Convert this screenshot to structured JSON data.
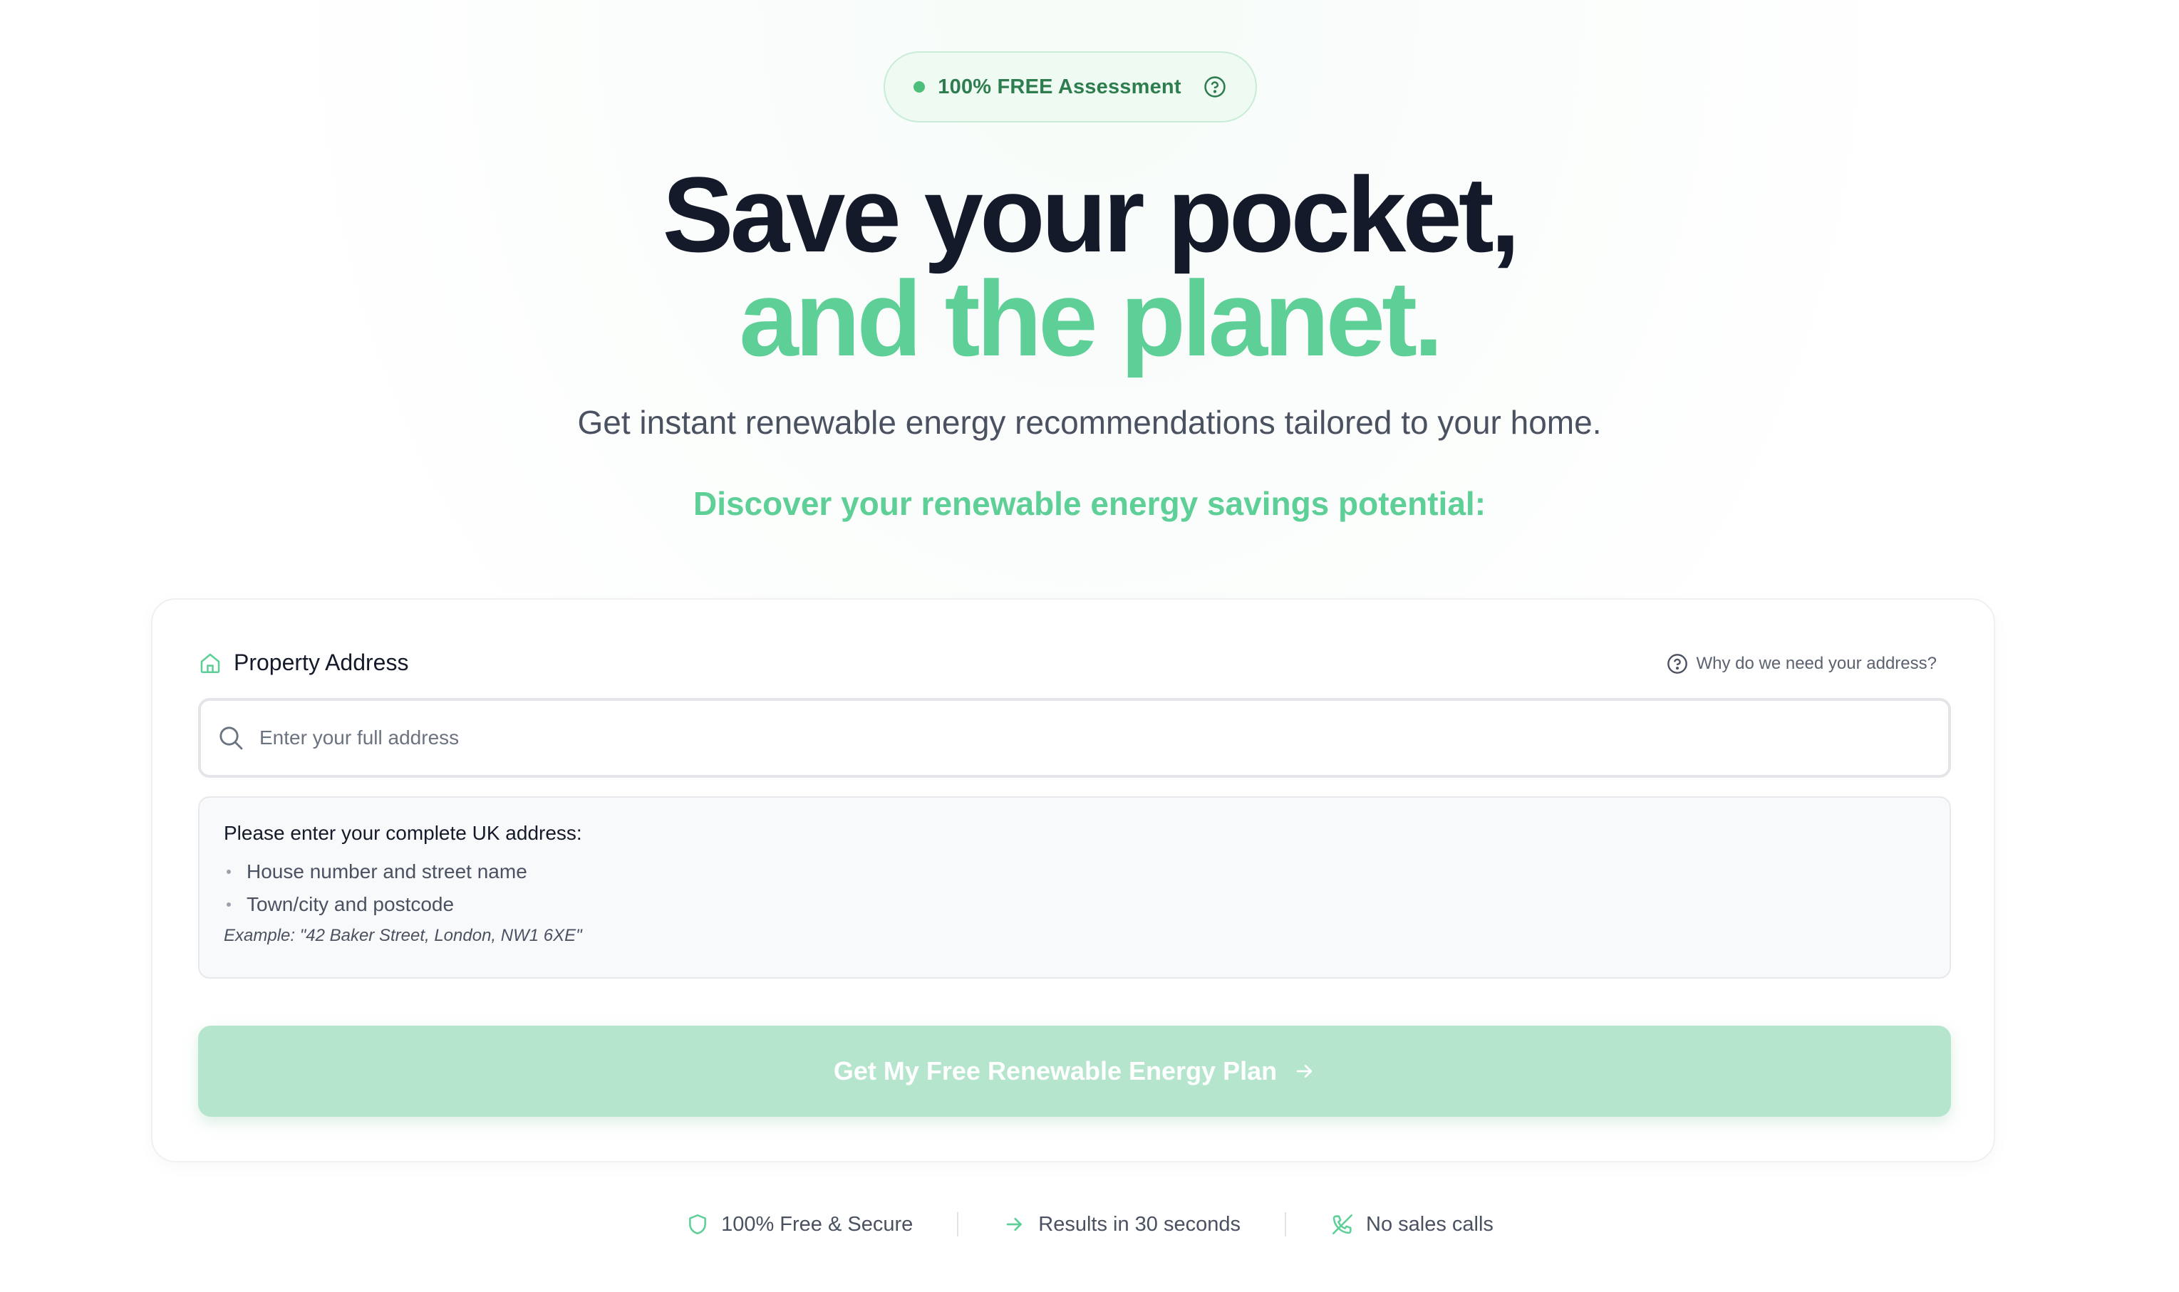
{
  "badge": {
    "label": "100% FREE Assessment",
    "dot_color": "#4ebf7a",
    "icon": "help-circle-icon"
  },
  "hero": {
    "headline_line1": "Save your pocket,",
    "headline_line2": "and the planet.",
    "subtitle": "Get instant renewable energy recommendations tailored to your home.",
    "discover": "Discover your renewable energy savings potential:"
  },
  "form": {
    "field_label": "Property Address",
    "field_icon": "home-icon",
    "why_link": "Why do we need your address?",
    "why_icon": "help-circle-icon",
    "address_input": {
      "placeholder": "Enter your full address",
      "value": "",
      "icon": "search-icon"
    },
    "hint": {
      "title": "Please enter your complete UK address:",
      "items": [
        "House number and street name",
        "Town/city and postcode"
      ],
      "example": "Example: \"42 Baker Street, London, NW1 6XE\""
    },
    "submit": {
      "label": "Get My Free Renewable Energy Plan",
      "icon": "arrow-right-icon",
      "state": "disabled"
    }
  },
  "trust": [
    {
      "label": "100% Free & Secure",
      "icon": "shield-icon"
    },
    {
      "label": "Results in 30 seconds",
      "icon": "arrow-right-icon"
    },
    {
      "label": "No sales calls",
      "icon": "phone-off-icon"
    }
  ],
  "colors": {
    "accent_green": "#5ecf97",
    "headline_dark": "#141a29",
    "button_disabled": "#b5e6cd",
    "badge_text": "#2e7d4f"
  }
}
